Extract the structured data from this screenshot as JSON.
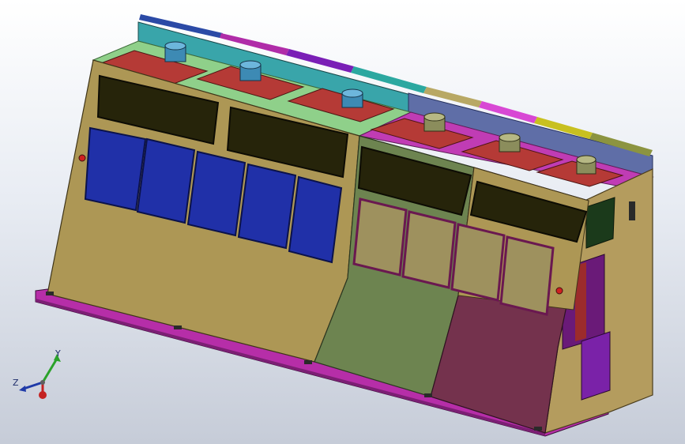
{
  "triad": {
    "x_label": "",
    "y_label": "Y",
    "z_label": "Z"
  },
  "colors": {
    "background_top": "#ffffff",
    "background_bottom": "#c6ccd8",
    "cabinet_tan": "#ad9755",
    "cabinet_green": "#6d8450",
    "cabinet_maroon": "#74324d",
    "side_tan": "#b49c5e",
    "window_blue": "#2030a8",
    "window_khaki": "#9e915e",
    "dark_panel": "#26240a",
    "top_red": "#b53a36",
    "base_magenta": "#b62ea8",
    "rail_teal": "#39a5aa",
    "rail_slate": "#5f6ea7",
    "fan_blue": "#3d8ab4",
    "fan_olive": "#8b8d5c"
  }
}
